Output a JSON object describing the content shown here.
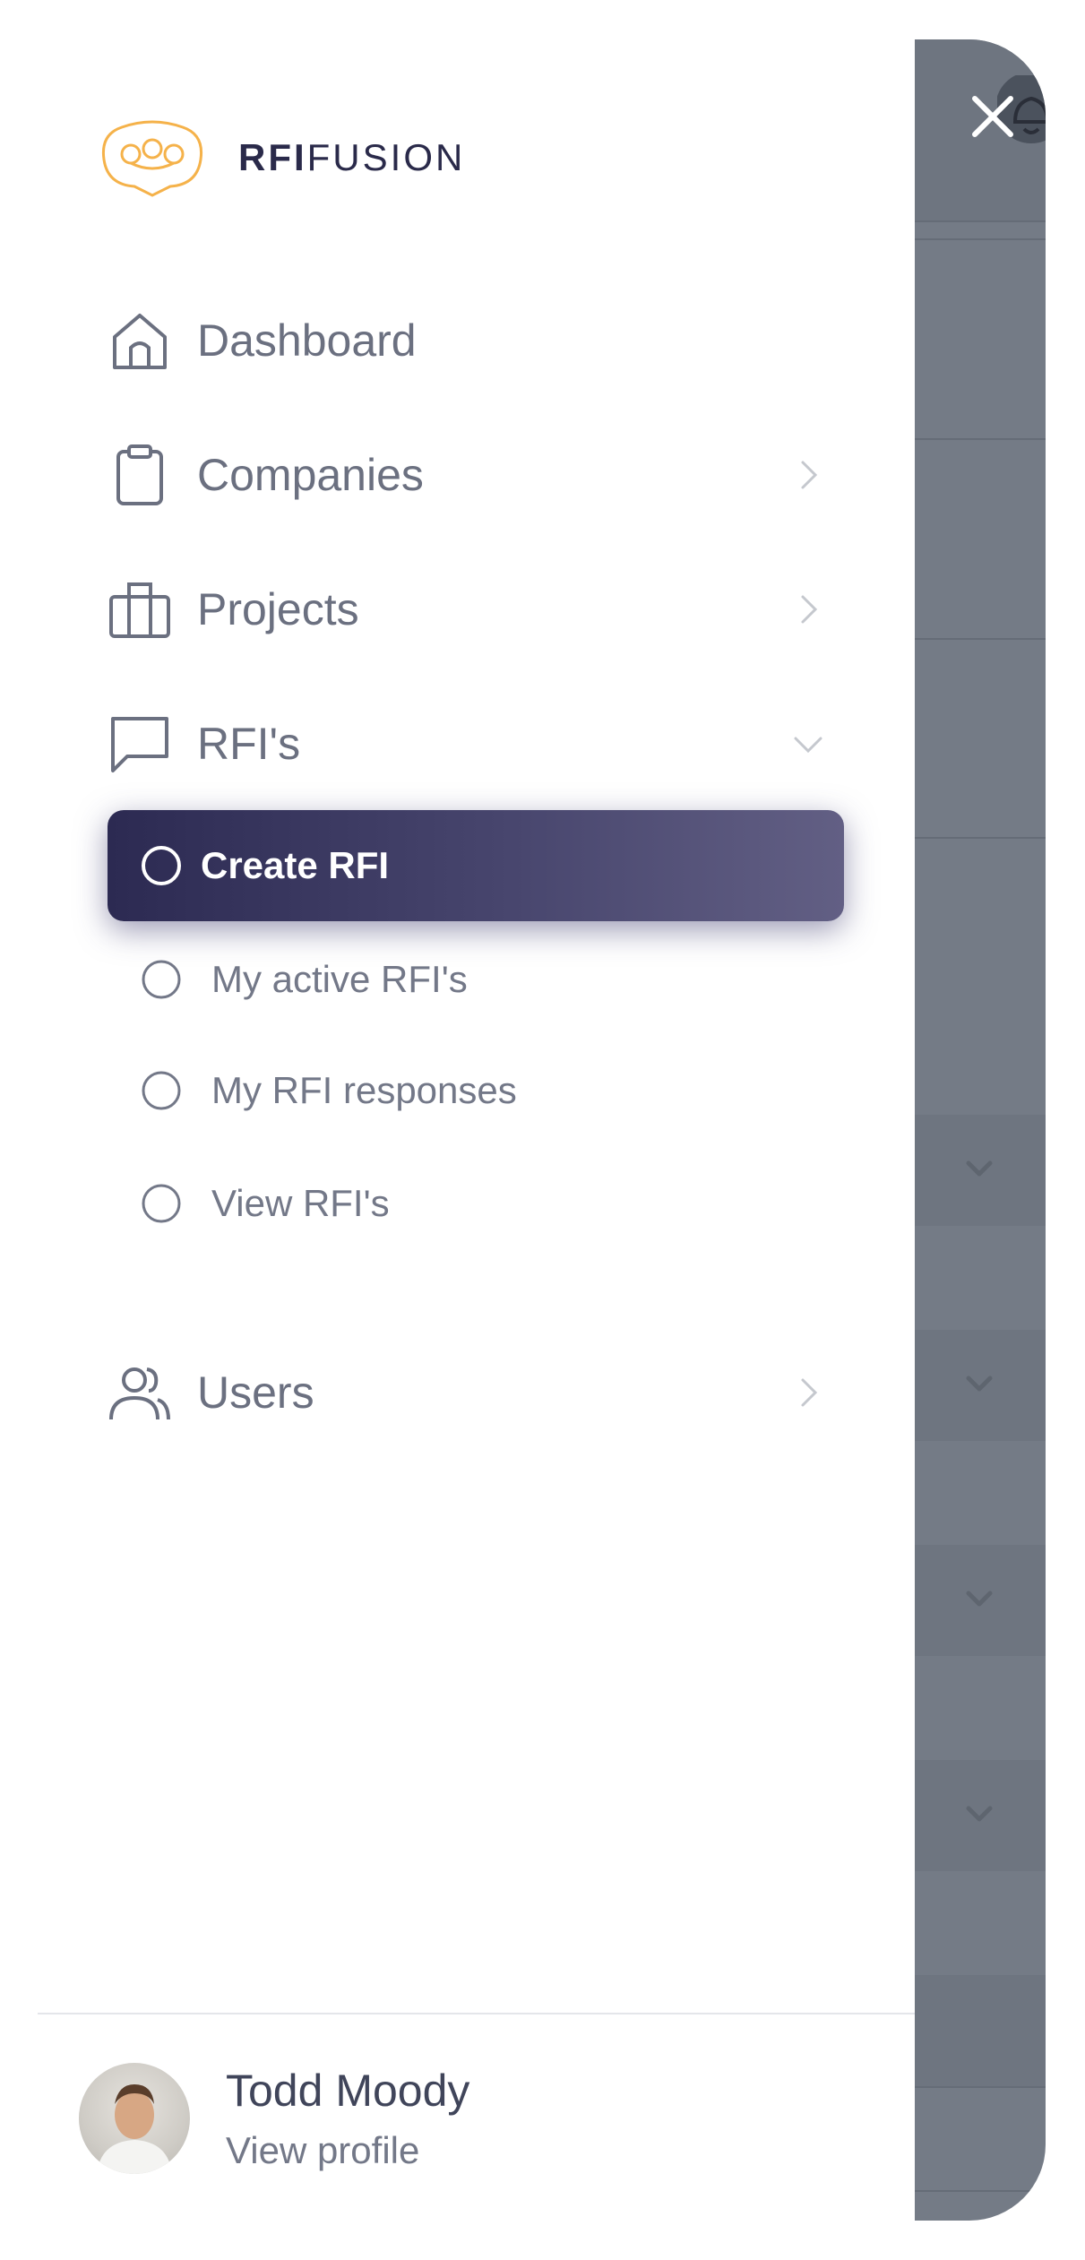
{
  "brand": {
    "name_bold": "RFI",
    "name_light": "FUSION"
  },
  "nav": {
    "dashboard": "Dashboard",
    "companies": "Companies",
    "projects": "Projects",
    "rfis": "RFI's",
    "users": "Users"
  },
  "rfi_submenu": {
    "create": "Create RFI",
    "active": "My active RFI's",
    "responses": "My RFI responses",
    "view": "View RFI's"
  },
  "profile": {
    "name": "Todd Moody",
    "link": "View profile"
  },
  "colors": {
    "active_gradient_start": "#2c2a52",
    "active_gradient_end": "#625f84",
    "brand_orange": "#f5b24a",
    "overlay": "#747b86"
  },
  "icons": [
    "close-icon",
    "bell-icon",
    "logo-icon",
    "home-icon",
    "clipboard-icon",
    "briefcase-icon",
    "chat-icon",
    "users-icon",
    "chevron-right-icon",
    "chevron-down-icon",
    "radio-icon"
  ]
}
